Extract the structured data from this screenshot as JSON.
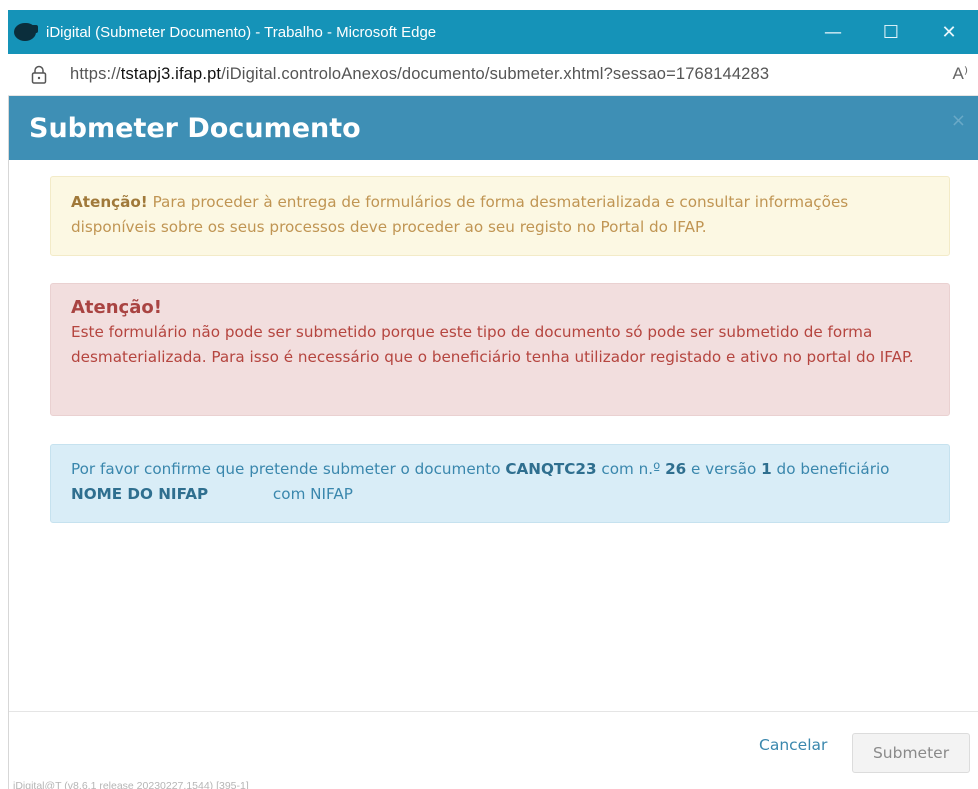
{
  "window": {
    "title": "iDigital (Submeter Documento) - Trabalho - Microsoft Edge",
    "minimize_label": "—",
    "maximize_label": "☐",
    "close_label": "✕",
    "app_icon": "edge-app-icon"
  },
  "address_bar": {
    "url_prefix": "https://",
    "url_host": "tstapj3.ifap.pt",
    "url_path": "/iDigital.controloAnexos/documento/submeter.xhtml?sessao=1768144283",
    "read_aloud_label": "A⁾",
    "lock_icon": "lock-icon"
  },
  "modal": {
    "title": "Submeter Documento",
    "close_label": "×",
    "warning": {
      "strong": "Atenção!",
      "text": " Para proceder à entrega de formulários de forma desmaterializada e consultar informações disponíveis sobre os seus processos deve proceder ao seu registo no Portal do IFAP."
    },
    "danger": {
      "heading": "Atenção!",
      "text": "Este formulário não pode ser submetido porque este tipo de documento só pode ser submetido de forma desmaterializada. Para isso é necessário que o beneficiário tenha utilizador registado e ativo no portal do IFAP."
    },
    "info": {
      "t1": "Por favor confirme que pretende submeter o documento ",
      "doc_code": "CANQTC23",
      "t2": " com n.º ",
      "doc_number": "26",
      "t3": " e versão ",
      "doc_version": "1",
      "t4": " do beneficiário ",
      "beneficiary": "NOME DO NIFAP",
      "t5": " com NIFAP "
    },
    "footer": {
      "cancel_label": "Cancelar",
      "submit_label": "Submeter",
      "version_text": "iDigital@T (v8.6.1 release 20230227.1544) [395-1]"
    }
  },
  "colors": {
    "titlebar": "#1593b8",
    "modal_header": "#3e8fb5",
    "warning_bg": "#fcf8e3",
    "danger_bg": "#f2dede",
    "info_bg": "#d9edf7"
  }
}
